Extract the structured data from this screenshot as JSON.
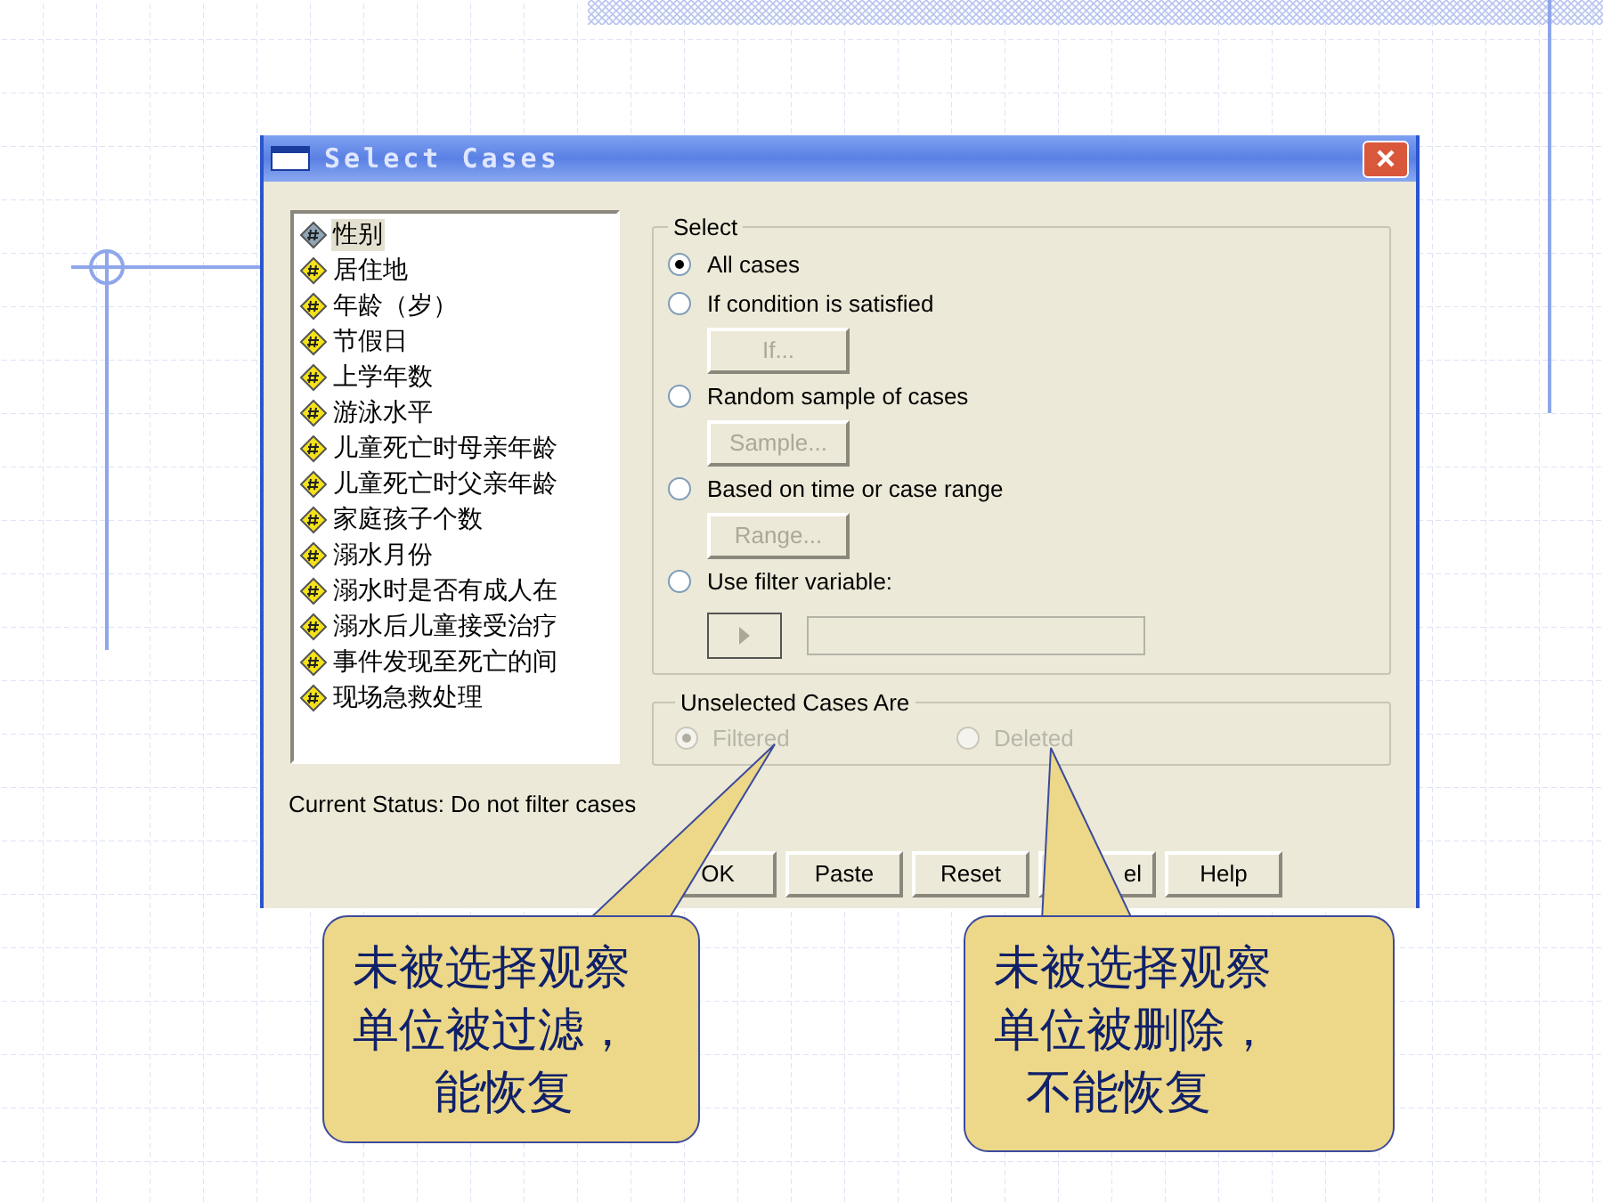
{
  "window": {
    "title": "Select Cases"
  },
  "variables": [
    {
      "label": "性别",
      "selected": true
    },
    {
      "label": "居住地",
      "selected": false
    },
    {
      "label": "年龄（岁）",
      "selected": false
    },
    {
      "label": "节假日",
      "selected": false
    },
    {
      "label": "上学年数",
      "selected": false
    },
    {
      "label": "游泳水平",
      "selected": false
    },
    {
      "label": "儿童死亡时母亲年龄",
      "selected": false
    },
    {
      "label": "儿童死亡时父亲年龄",
      "selected": false
    },
    {
      "label": "家庭孩子个数",
      "selected": false
    },
    {
      "label": "溺水月份",
      "selected": false
    },
    {
      "label": "溺水时是否有成人在",
      "selected": false
    },
    {
      "label": "溺水后儿童接受治疗",
      "selected": false
    },
    {
      "label": "事件发现至死亡的间",
      "selected": false
    },
    {
      "label": "现场急救处理",
      "selected": false
    }
  ],
  "select_group": {
    "title": "Select",
    "options": [
      {
        "kind": "plain",
        "label": "All cases",
        "selected": true
      },
      {
        "kind": "button",
        "label": "If condition is satisfied",
        "selected": false,
        "button": "If..."
      },
      {
        "kind": "button",
        "label": "Random sample of cases",
        "selected": false,
        "button": "Sample..."
      },
      {
        "kind": "button",
        "label": "Based on time or case range",
        "selected": false,
        "button": "Range..."
      },
      {
        "kind": "filter",
        "label": "Use filter variable:",
        "selected": false
      }
    ]
  },
  "unselected_group": {
    "title": "Unselected Cases Are",
    "disabled": true,
    "options": [
      {
        "label": "Filtered",
        "selected": true
      },
      {
        "label": "Deleted",
        "selected": false
      }
    ]
  },
  "status": "Current Status: Do not filter cases",
  "buttons": [
    "OK",
    "Paste",
    "Reset",
    "el",
    "Help"
  ],
  "callouts": [
    {
      "lines": [
        "未被选择观察",
        "单位被过滤，",
        "能恢复"
      ]
    },
    {
      "lines": [
        "未被选择观察",
        "单位被删除，",
        "不能恢复"
      ]
    }
  ]
}
